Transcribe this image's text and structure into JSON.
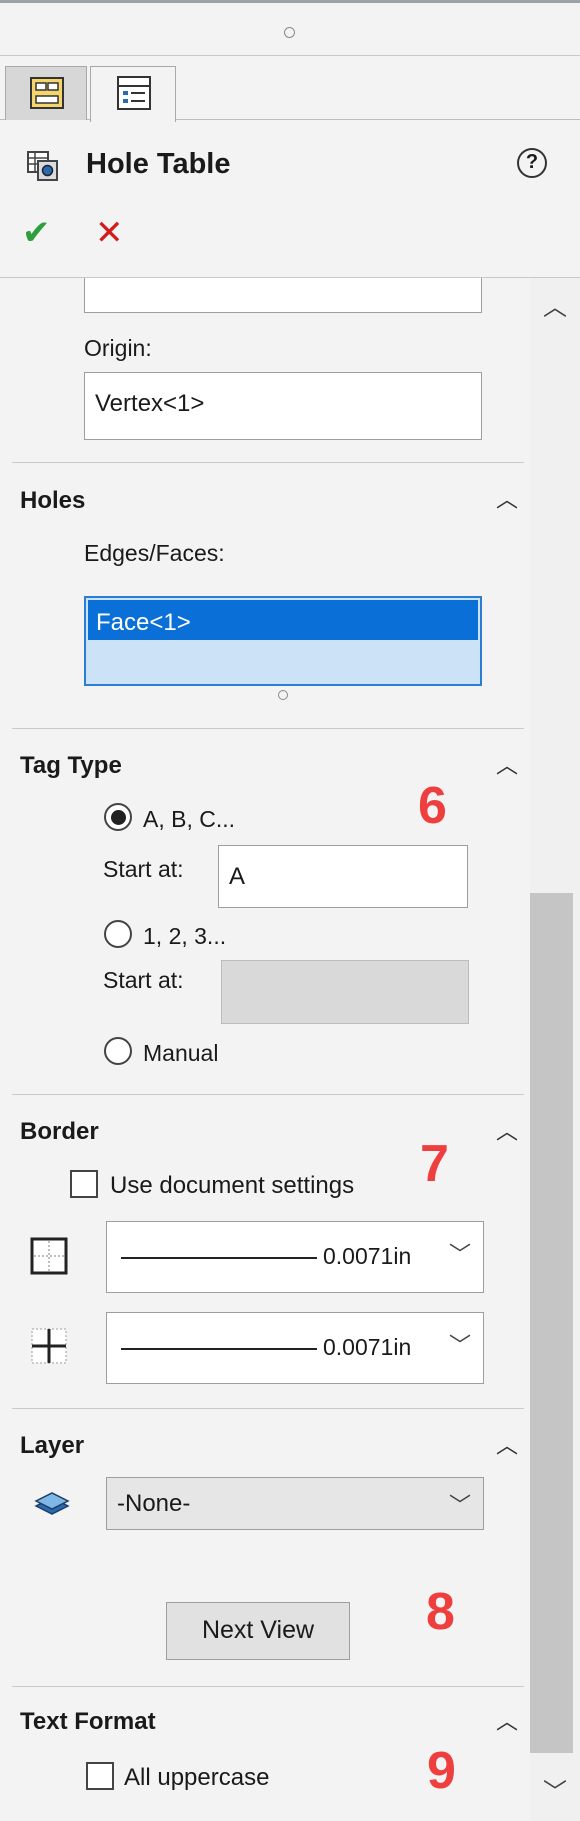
{
  "header": {
    "title": "Hole Table"
  },
  "icons": {
    "help": "help-icon",
    "ok": "checkmark-icon",
    "cancel": "close-icon"
  },
  "origin": {
    "label": "Origin:",
    "value": "Vertex<1>"
  },
  "holes": {
    "title": "Holes",
    "edges_label": "Edges/Faces:",
    "selected_item": "Face<1>"
  },
  "tag_type": {
    "title": "Tag Type",
    "option_letters": "A, B, C...",
    "start_label_1": "Start at:",
    "start_value_1": "A",
    "option_numbers": "1, 2, 3...",
    "start_label_2": "Start at:",
    "option_manual": "Manual",
    "marker": "6"
  },
  "border": {
    "title": "Border",
    "use_doc_settings": "Use document settings",
    "line_1_value": "0.0071in",
    "line_2_value": "0.0071in",
    "marker": "7"
  },
  "layer": {
    "title": "Layer",
    "value": "-None-",
    "next_view": "Next View",
    "marker": "8"
  },
  "text_format": {
    "title": "Text Format",
    "all_uppercase": "All uppercase",
    "marker": "9"
  },
  "glyphs": {
    "chevron_up": "︿",
    "chevron_down": "﹀",
    "check": "✔",
    "cross": "✕",
    "question": "?"
  }
}
